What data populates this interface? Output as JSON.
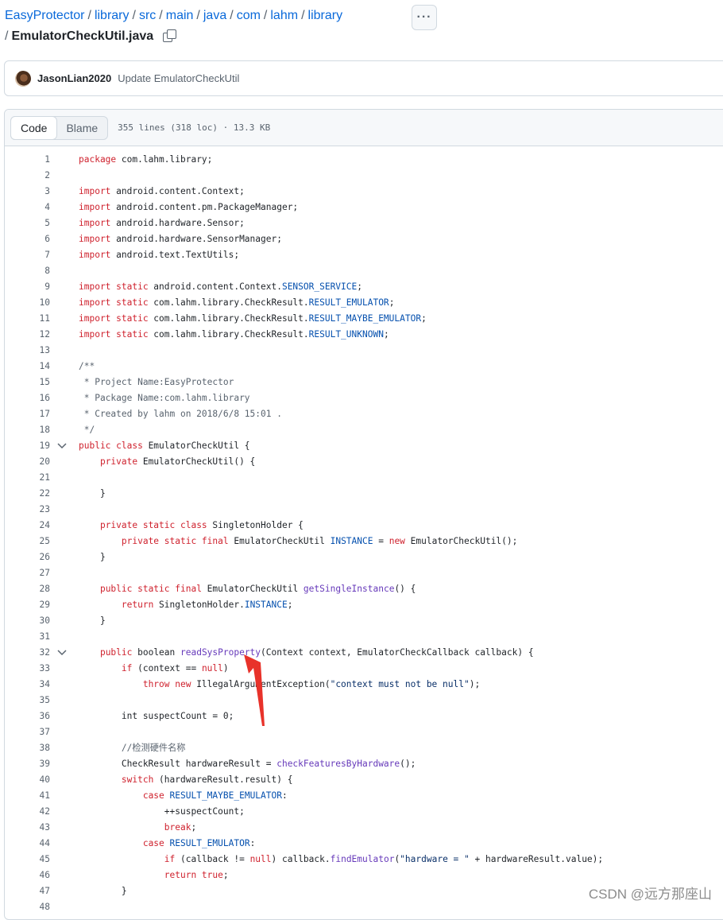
{
  "breadcrumb": {
    "repo": "EasyProtector",
    "path": [
      "library",
      "src",
      "main",
      "java",
      "com",
      "lahm",
      "library"
    ],
    "separator": "/",
    "file": "EmulatorCheckUtil.java"
  },
  "icons": {
    "copy": "copy-icon",
    "more": "kebab-horizontal-icon"
  },
  "more_button_label": "···",
  "commit": {
    "author": "JasonLian2020",
    "message": "Update EmulatorCheckUtil"
  },
  "file_header": {
    "tab_code": "Code",
    "tab_blame": "Blame",
    "meta": "355 lines (318 loc) · 13.3 KB"
  },
  "code_lines": [
    {
      "n": "1",
      "html": "<span class='k'>package</span> com.lahm.library;"
    },
    {
      "n": "2",
      "html": ""
    },
    {
      "n": "3",
      "html": "<span class='k'>import</span> android.content.Context;"
    },
    {
      "n": "4",
      "html": "<span class='k'>import</span> android.content.pm.PackageManager;"
    },
    {
      "n": "5",
      "html": "<span class='k'>import</span> android.hardware.Sensor;"
    },
    {
      "n": "6",
      "html": "<span class='k'>import</span> android.hardware.SensorManager;"
    },
    {
      "n": "7",
      "html": "<span class='k'>import</span> android.text.TextUtils;"
    },
    {
      "n": "8",
      "html": ""
    },
    {
      "n": "9",
      "html": "<span class='k'>import static</span> android.content.Context.<span class='cst'>SENSOR_SERVICE</span>;"
    },
    {
      "n": "10",
      "html": "<span class='k'>import static</span> com.lahm.library.CheckResult.<span class='cst'>RESULT_EMULATOR</span>;"
    },
    {
      "n": "11",
      "html": "<span class='k'>import static</span> com.lahm.library.CheckResult.<span class='cst'>RESULT_MAYBE_EMULATOR</span>;"
    },
    {
      "n": "12",
      "html": "<span class='k'>import static</span> com.lahm.library.CheckResult.<span class='cst'>RESULT_UNKNOWN</span>;"
    },
    {
      "n": "13",
      "html": ""
    },
    {
      "n": "14",
      "html": "<span class='c'>/**</span>"
    },
    {
      "n": "15",
      "html": "<span class='c'> * Project Name:EasyProtector</span>"
    },
    {
      "n": "16",
      "html": "<span class='c'> * Package Name:com.lahm.library</span>"
    },
    {
      "n": "17",
      "html": "<span class='c'> * Created by lahm on 2018/6/8 15:01 .</span>"
    },
    {
      "n": "18",
      "html": "<span class='c'> */</span>"
    },
    {
      "n": "19",
      "html": "<span class='k'>public class</span> EmulatorCheckUtil {",
      "fold": true
    },
    {
      "n": "20",
      "html": "    <span class='k'>private</span> EmulatorCheckUtil() {"
    },
    {
      "n": "21",
      "html": ""
    },
    {
      "n": "22",
      "html": "    }"
    },
    {
      "n": "23",
      "html": ""
    },
    {
      "n": "24",
      "html": "    <span class='k'>private static class</span> SingletonHolder {"
    },
    {
      "n": "25",
      "html": "        <span class='k'>private static final</span> EmulatorCheckUtil <span class='cst'>INSTANCE</span> = <span class='k'>new</span> EmulatorCheckUtil();"
    },
    {
      "n": "26",
      "html": "    }"
    },
    {
      "n": "27",
      "html": ""
    },
    {
      "n": "28",
      "html": "    <span class='k'>public static final</span> EmulatorCheckUtil <span class='f'>getSingleInstance</span>() {"
    },
    {
      "n": "29",
      "html": "        <span class='k'>return</span> SingletonHolder.<span class='cst'>INSTANCE</span>;"
    },
    {
      "n": "30",
      "html": "    }"
    },
    {
      "n": "31",
      "html": ""
    },
    {
      "n": "32",
      "html": "    <span class='k'>public</span> boolean <span class='f'>readSysProperty</span>(Context context, EmulatorCheckCallback callback) {",
      "fold": true
    },
    {
      "n": "33",
      "html": "        <span class='k'>if</span> (context == <span class='k'>null</span>)"
    },
    {
      "n": "34",
      "html": "            <span class='k'>throw new</span> IllegalArgumentException(<span class='s'>\"context must not be null\"</span>);"
    },
    {
      "n": "35",
      "html": ""
    },
    {
      "n": "36",
      "html": "        int suspectCount = 0;"
    },
    {
      "n": "37",
      "html": ""
    },
    {
      "n": "38",
      "html": "        <span class='c'>//检测硬件名称</span>"
    },
    {
      "n": "39",
      "html": "        CheckResult hardwareResult = <span class='f'>checkFeaturesByHardware</span>();"
    },
    {
      "n": "40",
      "html": "        <span class='k'>switch</span> (hardwareResult.result) {"
    },
    {
      "n": "41",
      "html": "            <span class='k'>case</span> <span class='cst'>RESULT_MAYBE_EMULATOR</span>:"
    },
    {
      "n": "42",
      "html": "                ++suspectCount;"
    },
    {
      "n": "43",
      "html": "                <span class='k'>break</span>;"
    },
    {
      "n": "44",
      "html": "            <span class='k'>case</span> <span class='cst'>RESULT_EMULATOR</span>:"
    },
    {
      "n": "45",
      "html": "                <span class='k'>if</span> (callback != <span class='k'>null</span>) callback.<span class='f'>findEmulator</span>(<span class='s'>\"hardware = \"</span> + hardwareResult.value);"
    },
    {
      "n": "46",
      "html": "                <span class='k'>return true</span>;"
    },
    {
      "n": "47",
      "html": "        }"
    },
    {
      "n": "48",
      "html": ""
    }
  ],
  "watermark": "CSDN @远方那座山",
  "colors": {
    "link": "#0969da",
    "keyword": "#cf222e",
    "annotation_arrow": "#e8322a"
  }
}
